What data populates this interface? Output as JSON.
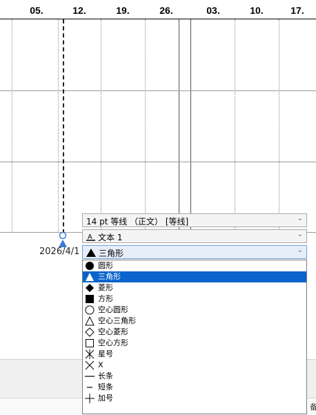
{
  "timeline": {
    "weeks": [
      "05.",
      "12.",
      "19.",
      "26.",
      "03.",
      "10.",
      "17."
    ],
    "milestone_label": "2026/4/1"
  },
  "format_panel": {
    "font": "14 pt 等线 （正文） [等线]",
    "text_style": "文本 1",
    "shape": "三角形"
  },
  "shape_options": [
    {
      "label": "圆形",
      "icon": "circle-filled-icon"
    },
    {
      "label": "三角形",
      "icon": "triangle-filled-icon",
      "selected": true
    },
    {
      "label": "菱形",
      "icon": "diamond-filled-icon"
    },
    {
      "label": "方形",
      "icon": "square-filled-icon"
    },
    {
      "label": "空心圆形",
      "icon": "circle-outline-icon"
    },
    {
      "label": "空心三角形",
      "icon": "triangle-outline-icon"
    },
    {
      "label": "空心菱形",
      "icon": "diamond-outline-icon"
    },
    {
      "label": "空心方形",
      "icon": "square-outline-icon"
    },
    {
      "label": "星号",
      "icon": "asterisk-icon"
    },
    {
      "label": "X",
      "icon": "x-icon"
    },
    {
      "label": "长条",
      "icon": "long-bar-icon"
    },
    {
      "label": "短条",
      "icon": "short-bar-icon"
    },
    {
      "label": "加号",
      "icon": "plus-icon"
    }
  ],
  "bottom_edge_text": "备",
  "colors": {
    "selected": "#0a64cc",
    "grid": "#9a9a9a",
    "milestone": "#3a7bd5"
  }
}
